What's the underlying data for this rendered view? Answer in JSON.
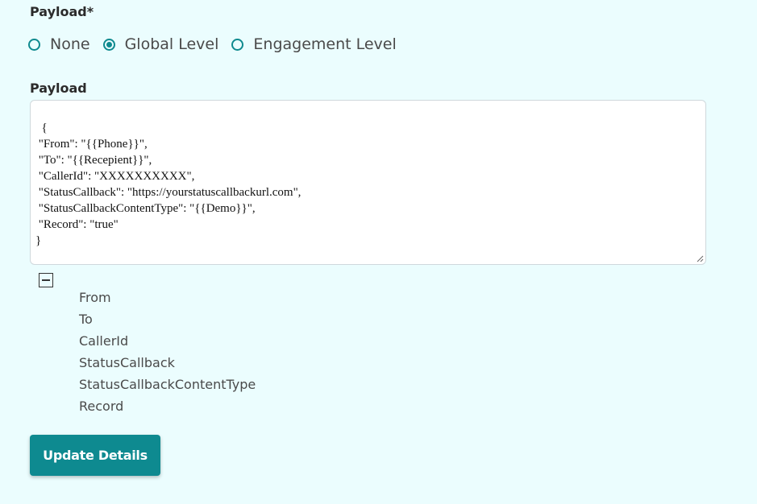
{
  "form": {
    "section_title": "Payload*",
    "payload_label": "Payload",
    "submit_label": "Update Details"
  },
  "payload_level": {
    "options": [
      {
        "label": "None",
        "checked": false
      },
      {
        "label": "Global Level",
        "checked": true
      },
      {
        "label": "Engagement Level",
        "checked": false
      }
    ]
  },
  "payload_text": "{\n \"From\": \"{{Phone}}\",\n \"To\": \"{{Recepient}}\",\n \"CallerId\": \"XXXXXXXXXX\",\n \"StatusCallback\": \"https://yourstatuscallbackurl.com\",\n \"StatusCallbackContentType\": \"{{Demo}}\",\n \"Record\": \"true\"\n}",
  "payload_keys": [
    "From",
    "To",
    "CallerId",
    "StatusCallback",
    "StatusCallbackContentType",
    "Record"
  ],
  "colors": {
    "accent": "#0e8a90",
    "background": "#ebfdfe"
  },
  "icons": {
    "collapse": "minus-square-icon",
    "resize": "resize-handle-icon"
  }
}
